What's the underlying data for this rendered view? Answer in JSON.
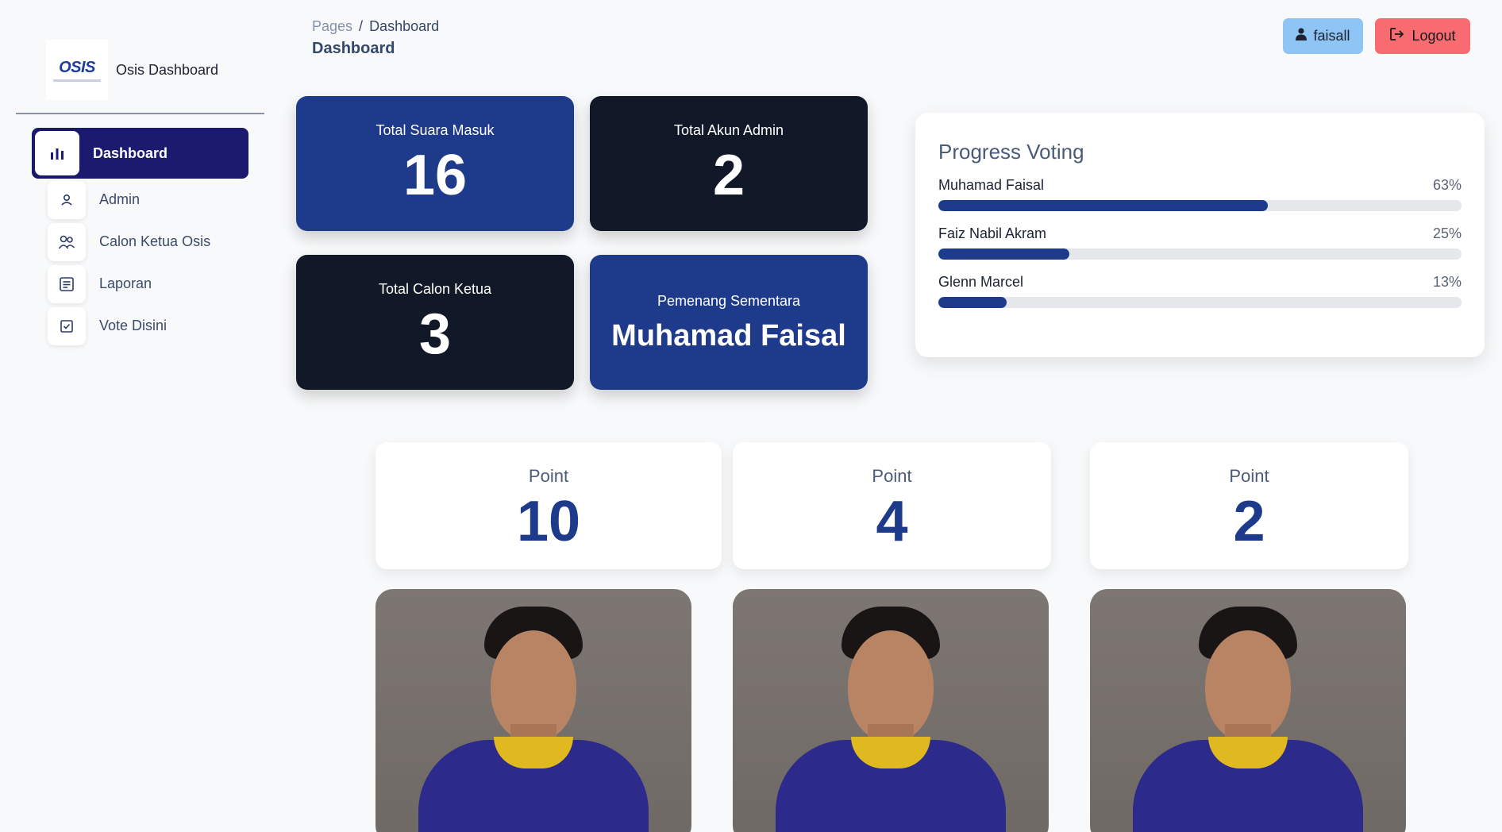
{
  "app": {
    "brand_title": "Osis Dashboard",
    "logo_text": "OSIS"
  },
  "sidebar": {
    "items": [
      {
        "label": "Dashboard",
        "icon": "bar-chart-icon",
        "active": true
      },
      {
        "label": "Admin",
        "icon": "user-icon",
        "active": false
      },
      {
        "label": "Calon Ketua Osis",
        "icon": "users-icon",
        "active": false
      },
      {
        "label": "Laporan",
        "icon": "document-icon",
        "active": false
      },
      {
        "label": "Vote Disini",
        "icon": "checkbox-icon",
        "active": false
      }
    ]
  },
  "header": {
    "breadcrumb_root": "Pages",
    "breadcrumb_sep": "/",
    "breadcrumb_current": "Dashboard",
    "title": "Dashboard",
    "user_label": "faisall",
    "logout_label": "Logout"
  },
  "stats": {
    "total_suara_label": "Total Suara Masuk",
    "total_suara_value": "16",
    "total_admin_label": "Total Akun Admin",
    "total_admin_value": "2",
    "total_calon_label": "Total Calon Ketua",
    "total_calon_value": "3",
    "pemenang_label": "Pemenang Sementara",
    "pemenang_value": "Muhamad Faisal"
  },
  "progress": {
    "title": "Progress Voting",
    "rows": [
      {
        "name": "Muhamad Faisal",
        "percent_label": "63%",
        "percent": 63
      },
      {
        "name": "Faiz Nabil Akram",
        "percent_label": "25%",
        "percent": 25
      },
      {
        "name": "Glenn Marcel",
        "percent_label": "13%",
        "percent": 13
      }
    ]
  },
  "points": [
    {
      "label": "Point",
      "value": "10"
    },
    {
      "label": "Point",
      "value": "4"
    },
    {
      "label": "Point",
      "value": "2"
    }
  ],
  "colors": {
    "primary_blue": "#1e3a8a",
    "dark": "#111827",
    "sidebar_active": "#1b1a6e",
    "user_button": "#8ec5f5",
    "logout_button": "#f76b71"
  }
}
